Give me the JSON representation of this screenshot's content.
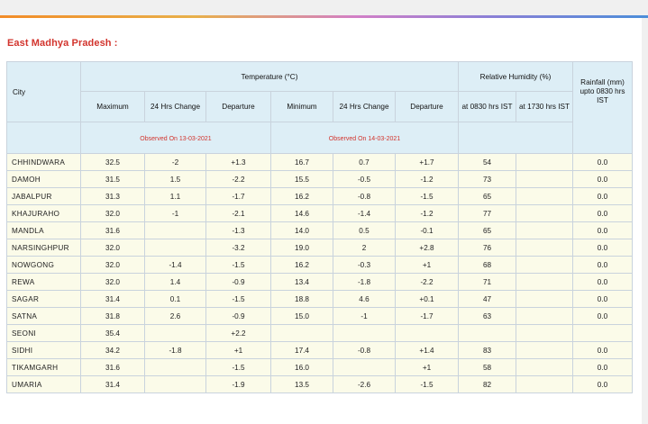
{
  "section_title": "East Madhya Pradesh :",
  "headers": {
    "city": "City",
    "temperature_group": "Temperature (°C)",
    "humidity_group": "Relative Humidity (%)",
    "rainfall": "Rainfall (mm) upto 0830 hrs IST",
    "maximum": "Maximum",
    "change_24h_max": "24 Hrs Change",
    "departure_max": "Departure",
    "minimum": "Minimum",
    "change_24h_min": "24 Hrs Change",
    "departure_min": "Departure",
    "rh_0830": "at 0830 hrs IST",
    "rh_1730": "at 1730 hrs IST",
    "observed_max": "Observed On 13-03-2021",
    "observed_min": "Observed On 14-03-2021"
  },
  "rows": [
    [
      "CHHINDWARA",
      "32.5",
      "-2",
      "+1.3",
      "16.7",
      "0.7",
      "+1.7",
      "54",
      "",
      "0.0"
    ],
    [
      "DAMOH",
      "31.5",
      "1.5",
      "-2.2",
      "15.5",
      "-0.5",
      "-1.2",
      "73",
      "",
      "0.0"
    ],
    [
      "JABALPUR",
      "31.3",
      "1.1",
      "-1.7",
      "16.2",
      "-0.8",
      "-1.5",
      "65",
      "",
      "0.0"
    ],
    [
      "KHAJURAHO",
      "32.0",
      "-1",
      "-2.1",
      "14.6",
      "-1.4",
      "-1.2",
      "77",
      "",
      "0.0"
    ],
    [
      "MANDLA",
      "31.6",
      "",
      "-1.3",
      "14.0",
      "0.5",
      "-0.1",
      "65",
      "",
      "0.0"
    ],
    [
      "NARSINGHPUR",
      "32.0",
      "",
      "-3.2",
      "19.0",
      "2",
      "+2.8",
      "76",
      "",
      "0.0"
    ],
    [
      "NOWGONG",
      "32.0",
      "-1.4",
      "-1.5",
      "16.2",
      "-0.3",
      "+1",
      "68",
      "",
      "0.0"
    ],
    [
      "REWA",
      "32.0",
      "1.4",
      "-0.9",
      "13.4",
      "-1.8",
      "-2.2",
      "71",
      "",
      "0.0"
    ],
    [
      "SAGAR",
      "31.4",
      "0.1",
      "-1.5",
      "18.8",
      "4.6",
      "+0.1",
      "47",
      "",
      "0.0"
    ],
    [
      "SATNA",
      "31.8",
      "2.6",
      "-0.9",
      "15.0",
      "-1",
      "-1.7",
      "63",
      "",
      "0.0"
    ],
    [
      "SEONI",
      "35.4",
      "",
      "+2.2",
      "",
      "",
      "",
      "",
      "",
      ""
    ],
    [
      "SIDHI",
      "34.2",
      "-1.8",
      "+1",
      "17.4",
      "-0.8",
      "+1.4",
      "83",
      "",
      "0.0"
    ],
    [
      "TIKAMGARH",
      "31.6",
      "",
      "-1.5",
      "16.0",
      "",
      "+1",
      "58",
      "",
      "0.0"
    ],
    [
      "UMARIA",
      "31.4",
      "",
      "-1.9",
      "13.5",
      "-2.6",
      "-1.5",
      "82",
      "",
      "0.0"
    ]
  ]
}
